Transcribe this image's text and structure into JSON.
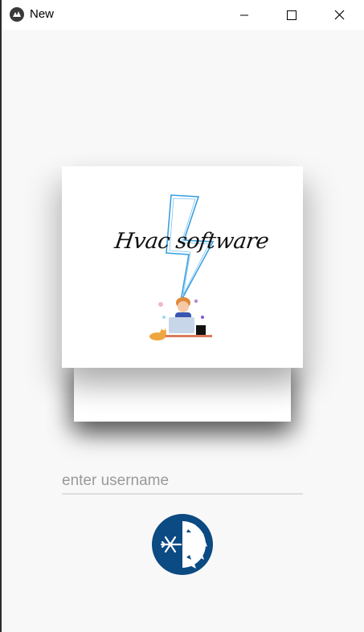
{
  "window": {
    "title": "New",
    "title_icon": "kivy-logo-icon",
    "controls": [
      "minimize-icon",
      "maximize-icon",
      "close-icon"
    ]
  },
  "logo_card": {
    "brand_text": "Hvac software",
    "graphics": [
      "lightning-bolt-icon",
      "person-at-laptop-illustration",
      "cat-icon"
    ]
  },
  "login": {
    "username_placeholder": "enter username",
    "username_value": ""
  },
  "theme_toggle": {
    "icon": "snowflake-sun-icon",
    "color": "#0b4a82"
  },
  "colors": {
    "background": "#f8f8f8",
    "accent": "#0b4a82",
    "bolt": "#3aa0de"
  }
}
